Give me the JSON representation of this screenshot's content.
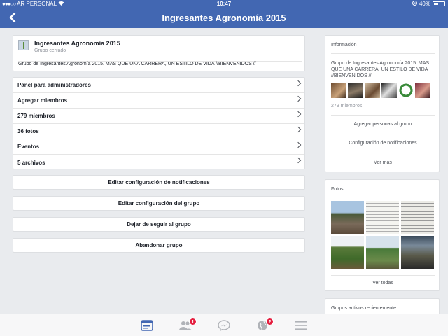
{
  "status": {
    "carrier": "AR PERSONAL",
    "time": "10:47",
    "battery": "40%"
  },
  "nav": {
    "title": "Ingresantes Agronomía 2015"
  },
  "group": {
    "name": "Ingresantes Agronomía 2015",
    "privacy": "Grupo cerrado",
    "description": "Grupo de Ingresantes Agronomía 2015. MAS QUE UNA CARRERA, UN ESTILO DE VIDA //BIENVENIDOS //"
  },
  "menu": [
    {
      "label": "Panel para administradores"
    },
    {
      "label": "Agregar miembros"
    },
    {
      "label": "279 miembros"
    },
    {
      "label": "36 fotos"
    },
    {
      "label": "Eventos"
    },
    {
      "label": "5 archivos"
    }
  ],
  "actions": {
    "edit_notifications": "Editar configuración de notificaciones",
    "edit_group": "Editar configuración del grupo",
    "unfollow": "Dejar de seguir al grupo",
    "leave": "Abandonar grupo"
  },
  "info": {
    "title": "Información",
    "description": "Grupo de Ingresantes Agronomía 2015. MAS QUE UNA CARRERA, UN ESTILO DE VIDA //BIENVENIDOS //",
    "members": "279 miembros",
    "add_people": "Agregar personas al grupo",
    "notif_settings": "Configuración de notificaciones",
    "see_more": "Ver más"
  },
  "photos": {
    "title": "Fotos",
    "see_all": "Ver todas"
  },
  "recent": {
    "title": "Grupos activos recientemente"
  },
  "tabbar": {
    "friends_badge": "1",
    "notifications_badge": "2"
  },
  "colors": {
    "brand": "#4267b2",
    "badge": "#e41e3f",
    "active_tab": "#4267b2"
  }
}
